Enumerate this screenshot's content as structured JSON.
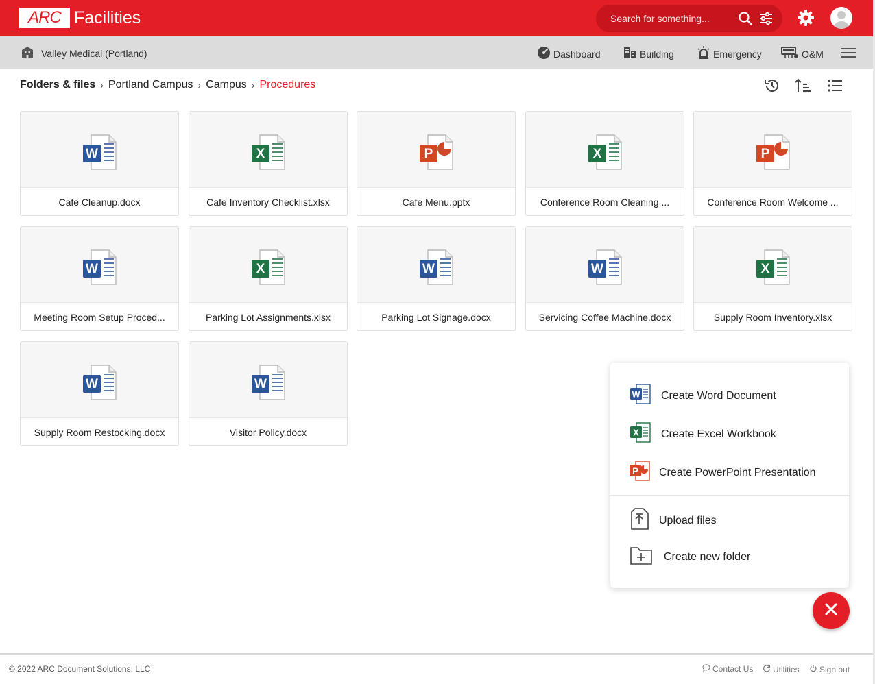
{
  "app": {
    "logo_text": "ARC",
    "title": "Facilities"
  },
  "search": {
    "placeholder": "Search for something..."
  },
  "subnav": {
    "site_label": "Valley Medical (Portland)",
    "items": [
      {
        "label": "Dashboard",
        "icon": "speedometer-icon"
      },
      {
        "label": "Building",
        "icon": "building-icon"
      },
      {
        "label": "Emergency",
        "icon": "siren-icon"
      },
      {
        "label": "O&M",
        "icon": "equipment-icon"
      }
    ]
  },
  "breadcrumb": {
    "root": "Folders & files",
    "items": [
      "Portland Campus",
      "Campus"
    ],
    "current": "Procedures"
  },
  "files": [
    {
      "name": "Cafe Cleanup.docx",
      "type": "word"
    },
    {
      "name": "Cafe Inventory Checklist.xlsx",
      "type": "excel"
    },
    {
      "name": "Cafe Menu.pptx",
      "type": "powerpoint"
    },
    {
      "name": "Conference Room Cleaning ...",
      "type": "excel"
    },
    {
      "name": "Conference Room Welcome ...",
      "type": "powerpoint"
    },
    {
      "name": "Meeting Room Setup Proced...",
      "type": "word"
    },
    {
      "name": "Parking Lot Assignments.xlsx",
      "type": "excel"
    },
    {
      "name": "Parking Lot Signage.docx",
      "type": "word"
    },
    {
      "name": "Servicing Coffee Machine.docx",
      "type": "word"
    },
    {
      "name": "Supply Room Inventory.xlsx",
      "type": "excel"
    },
    {
      "name": "Supply Room Restocking.docx",
      "type": "word"
    },
    {
      "name": "Visitor Policy.docx",
      "type": "word"
    }
  ],
  "create_menu": {
    "word": "Create Word Document",
    "excel": "Create Excel Workbook",
    "powerpoint": "Create PowerPoint Presentation",
    "upload": "Upload files",
    "folder": "Create new folder"
  },
  "footer": {
    "copyright": "© 2022 ARC Document Solutions, LLC",
    "contact": "Contact Us",
    "utilities": "Utilities",
    "signout": "Sign out"
  },
  "colors": {
    "brand_red": "#e41e26",
    "word_blue": "#2b579a",
    "excel_green": "#217346",
    "powerpoint_red": "#d24726"
  }
}
